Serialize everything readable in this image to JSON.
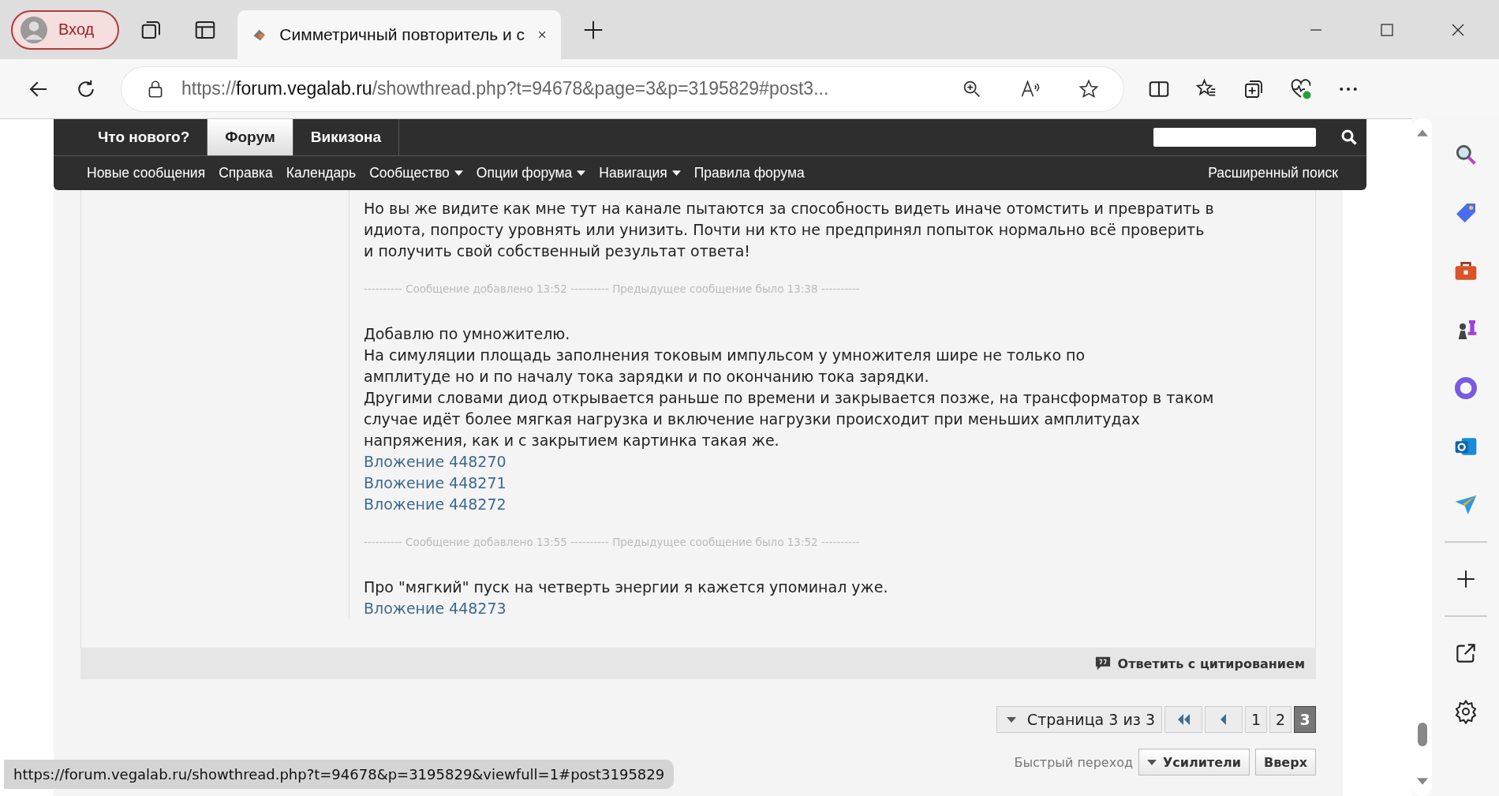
{
  "browser": {
    "profile": "Вход",
    "tab_title": "Симметричный повторитель и с",
    "url_scheme": "https://",
    "url_host": "forum.vegalab.ru",
    "url_rest": "/showthread.php?t=94678&page=3&p=3195829#post3..."
  },
  "nav": {
    "tabs": [
      {
        "label": "Что нового?",
        "selected": false
      },
      {
        "label": "Форум",
        "selected": true
      },
      {
        "label": "Викизона",
        "selected": false
      }
    ],
    "links": [
      {
        "label": "Новые сообщения",
        "dropdown": false
      },
      {
        "label": "Справка",
        "dropdown": false
      },
      {
        "label": "Календарь",
        "dropdown": false
      },
      {
        "label": "Сообщество",
        "dropdown": true
      },
      {
        "label": "Опции форума",
        "dropdown": true
      },
      {
        "label": "Навигация",
        "dropdown": true
      },
      {
        "label": "Правила форума",
        "dropdown": false
      }
    ],
    "advanced_search": "Расширенный поиск"
  },
  "post": {
    "blocks": [
      {
        "kind": "text",
        "lines": [
          "Но вы же видите как мне тут на канале пытаются за способность видеть иначе отомстить и превратить в",
          "идиота, попросту уровнять или унизить. Почти ни кто не предпринял попыток нормально всё проверить",
          "и получить свой собственный результат ответа!"
        ]
      },
      {
        "kind": "separator",
        "text": "---------- Сообщение добавлено 13:52 ---------- Предыдущее сообщение было 13:38 ----------"
      },
      {
        "kind": "text",
        "lines": [
          "Добавлю по умножителю.",
          "На симуляции площадь заполнения токовым импульсом у умножителя шире не только по",
          "амплитуде но и по началу тока зарядки и по окончанию тока зарядки.",
          "Другими словами диод открывается раньше по времени и закрывается позже, на трансформатор в таком",
          "случае идёт более мягкая нагрузка и включение нагрузки происходит при меньших амплитудах",
          "напряжения, как и с закрытием картинка такая же."
        ]
      },
      {
        "kind": "link",
        "text": "Вложение 448270"
      },
      {
        "kind": "link",
        "text": "Вложение 448271"
      },
      {
        "kind": "link",
        "text": "Вложение 448272"
      },
      {
        "kind": "separator",
        "text": "---------- Сообщение добавлено 13:55 ---------- Предыдущее сообщение было 13:52 ----------"
      },
      {
        "kind": "text",
        "lines": [
          "Про \"мягкий\" пуск на четверть энергии я кажется упоминал уже."
        ]
      },
      {
        "kind": "link",
        "text": "Вложение 448273"
      }
    ],
    "reply_quote": "Ответить с цитированием"
  },
  "pagination": {
    "label": "Страница 3 из 3",
    "pages": [
      {
        "label": "1",
        "selected": false
      },
      {
        "label": "2",
        "selected": false
      },
      {
        "label": "3",
        "selected": true
      }
    ]
  },
  "quick_nav": {
    "label": "Быстрый переход",
    "forum": "Усилители",
    "top": "Вверх"
  },
  "status_url": "https://forum.vegalab.ru/showthread.php?t=94678&p=3195829&viewfull=1#post3195829",
  "sidebar": [
    {
      "kind": "search"
    },
    {
      "kind": "tag"
    },
    {
      "kind": "toolbox"
    },
    {
      "kind": "chess"
    },
    {
      "kind": "copilot"
    },
    {
      "kind": "mail"
    },
    {
      "kind": "send"
    },
    {
      "kind": "divider"
    },
    {
      "kind": "add"
    },
    {
      "kind": "divider"
    },
    {
      "kind": "external"
    },
    {
      "kind": "settings"
    }
  ]
}
